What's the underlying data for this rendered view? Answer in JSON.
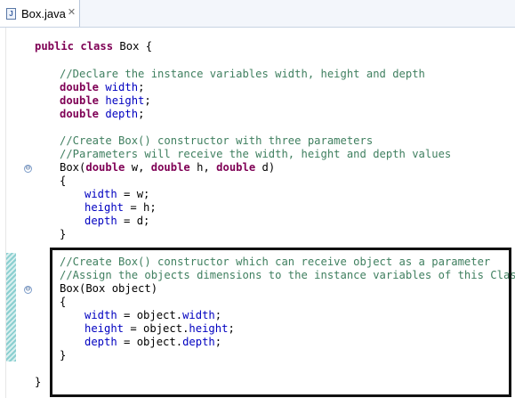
{
  "tab": {
    "icon_letter": "J",
    "filename": "Box.java",
    "close_glyph": "✕"
  },
  "code": {
    "class_decl": {
      "kw": "public class",
      "rest": " Box {"
    },
    "comment1": "//Declare the instance variables width, height and depth",
    "fields": [
      {
        "type": "double",
        "name": "width"
      },
      {
        "type": "double",
        "name": "height"
      },
      {
        "type": "double",
        "name": "depth"
      }
    ],
    "comment2": "//Create Box() constructor with three parameters",
    "comment3": "//Parameters will receive the width, height and depth values",
    "ctor1": {
      "name": "Box(",
      "type1": "double",
      "p1": " w, ",
      "type2": "double",
      "p2": " h, ",
      "type3": "double",
      "p3": " d)"
    },
    "open_brace": "{",
    "assign1": [
      {
        "field": "width",
        "rest": " = w;"
      },
      {
        "field": "height",
        "rest": " = h;"
      },
      {
        "field": "depth",
        "rest": " = d;"
      }
    ],
    "close_brace": "}",
    "comment4": "//Create Box() constructor which can receive object as a parameter",
    "comment5": "//Assign the objects dimensions to the instance variables of this Class",
    "ctor2": "Box(Box object)",
    "assign2": [
      {
        "field": "width",
        "mid": " = object.",
        "field2": "width",
        "end": ";"
      },
      {
        "field": "height",
        "mid": " = object.",
        "field2": "height",
        "end": ";"
      },
      {
        "field": "depth",
        "mid": " = object.",
        "field2": "depth",
        "end": ";"
      }
    ],
    "class_close": "}",
    "fold_glyph": "⊖"
  }
}
